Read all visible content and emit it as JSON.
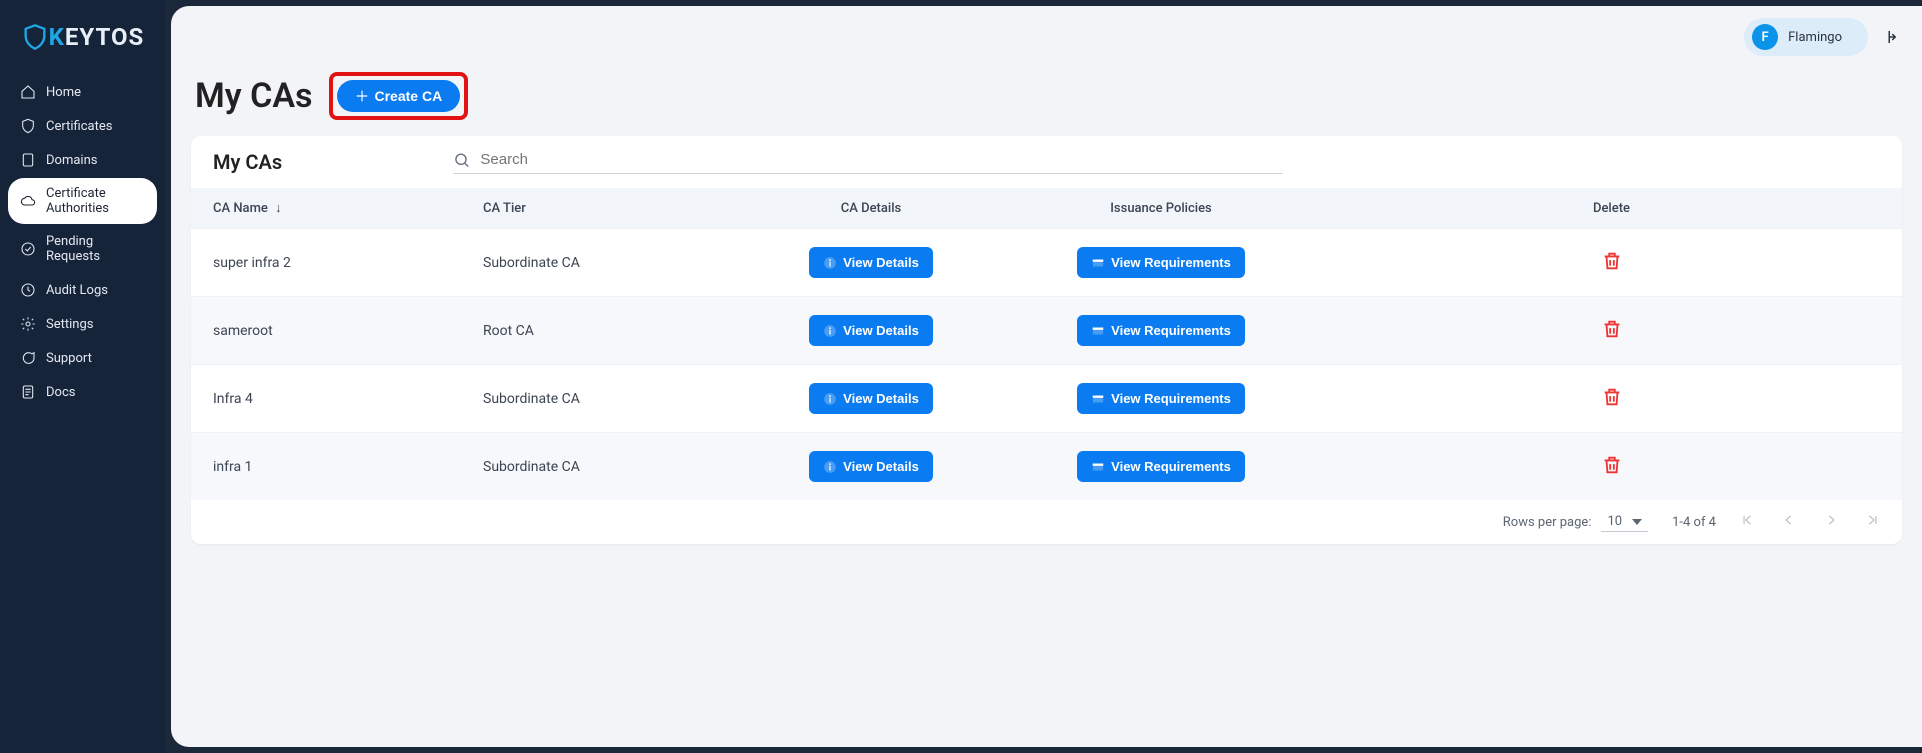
{
  "logo": {
    "name": "KEYTOS",
    "prefix": "K",
    "rest": "EYTOS"
  },
  "sidebar": {
    "items": [
      {
        "label": "Home"
      },
      {
        "label": "Certificates"
      },
      {
        "label": "Domains"
      },
      {
        "label": "Certificate Authorities",
        "active": true
      },
      {
        "label": "Pending Requests"
      },
      {
        "label": "Audit Logs"
      },
      {
        "label": "Settings"
      },
      {
        "label": "Support"
      },
      {
        "label": "Docs"
      }
    ]
  },
  "user": {
    "initial": "F",
    "name": "Flamingo"
  },
  "page": {
    "title": "My CAs",
    "create_label": "Create CA",
    "card_title": "My CAs",
    "search_placeholder": "Search"
  },
  "table": {
    "columns": {
      "ca_name": "CA Name",
      "ca_tier": "CA Tier",
      "ca_details": "CA Details",
      "issuance": "Issuance Policies",
      "delete": "Delete"
    },
    "details_btn": "View Details",
    "req_btn": "View Requirements",
    "rows": [
      {
        "name": "super infra 2",
        "tier": "Subordinate CA"
      },
      {
        "name": "sameroot",
        "tier": "Root CA"
      },
      {
        "name": "Infra 4",
        "tier": "Subordinate CA"
      },
      {
        "name": "infra 1",
        "tier": "Subordinate CA"
      }
    ]
  },
  "pagination": {
    "rows_per_page_label": "Rows per page:",
    "rows_per_page_value": "10",
    "range": "1-4 of 4"
  }
}
